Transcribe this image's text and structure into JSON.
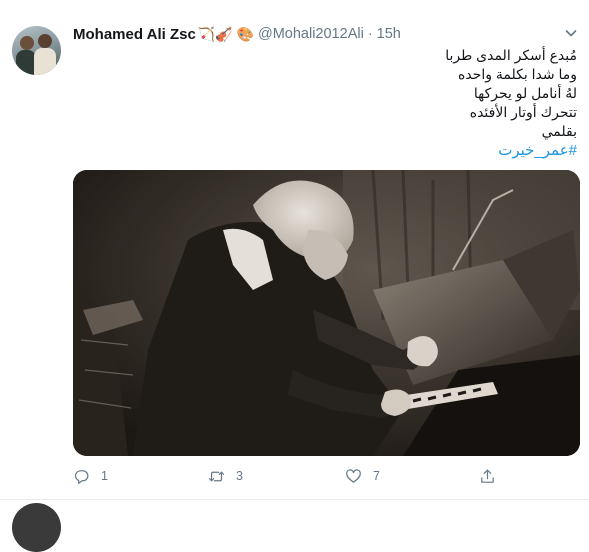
{
  "tweet": {
    "display_name": "Mohamed Ali Zsc",
    "name_emojis": "🏹🎻 🎨",
    "handle": "@Mohali2012Ali",
    "separator": "·",
    "time": "15h",
    "lines": [
      "مُبدع أسكر المدى طربا",
      "وما شدا بكلمة واحده",
      "لهُ أنامل لو يحركها",
      "تتحرك أوتار الأفئده",
      "بقلمي"
    ],
    "hashtag": "#عمر_خيرت",
    "actions": {
      "reply_count": "1",
      "retweet_count": "3",
      "like_count": "7"
    }
  },
  "icons": {
    "more": "chevron-down-icon",
    "reply": "reply-icon",
    "retweet": "retweet-icon",
    "like": "heart-icon",
    "share": "share-icon"
  },
  "colors": {
    "text": "#14171a",
    "secondary": "#657786",
    "link": "#1b95e0",
    "divider": "#e6ecf0"
  }
}
